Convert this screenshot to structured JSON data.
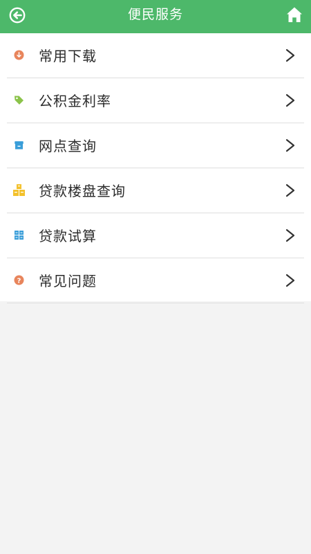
{
  "header": {
    "title": "便民服务",
    "back_icon": "back-arrow-circle-icon",
    "home_icon": "home-icon",
    "background": "#4db86a"
  },
  "menu": {
    "items": [
      {
        "label": "常用下载",
        "icon": "download-icon",
        "icon_color": "#e8855c"
      },
      {
        "label": "公积金利率",
        "icon": "tag-icon",
        "icon_color": "#8bc34a"
      },
      {
        "label": "网点查询",
        "icon": "store-icon",
        "icon_color": "#3a9ed9"
      },
      {
        "label": "贷款楼盘查询",
        "icon": "buildings-icon",
        "icon_color": "#f3c12c"
      },
      {
        "label": "贷款试算",
        "icon": "calculator-grid-icon",
        "icon_color": "#3a9ed9"
      },
      {
        "label": "常见问题",
        "icon": "question-icon",
        "icon_color": "#e8855c"
      }
    ],
    "chevron_icon": "chevron-right-icon"
  }
}
